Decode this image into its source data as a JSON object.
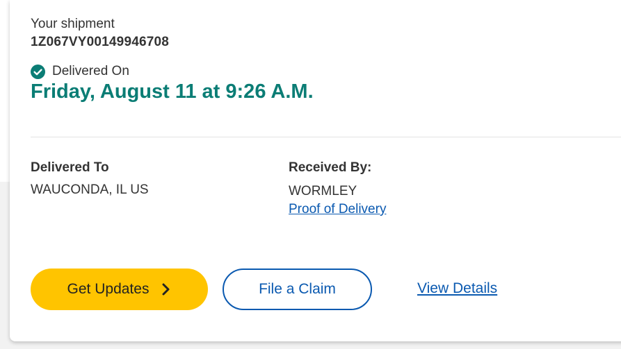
{
  "colors": {
    "accent_teal": "#0b7d75",
    "link_blue": "#0a59b0",
    "button_yellow": "#ffc400"
  },
  "shipment": {
    "label": "Your shipment",
    "tracking_number": "1Z067VY00149946708"
  },
  "status": {
    "icon": "check-circle-icon",
    "label": "Delivered On",
    "date": "Friday, August 11 at 9:26 A.M."
  },
  "delivered_to": {
    "label": "Delivered To",
    "value": "WAUCONDA, IL US"
  },
  "received_by": {
    "label": "Received By:",
    "value": "WORMLEY",
    "proof_link": "Proof of Delivery"
  },
  "actions": {
    "get_updates": "Get Updates",
    "file_claim": "File a Claim",
    "view_details": "View Details"
  }
}
